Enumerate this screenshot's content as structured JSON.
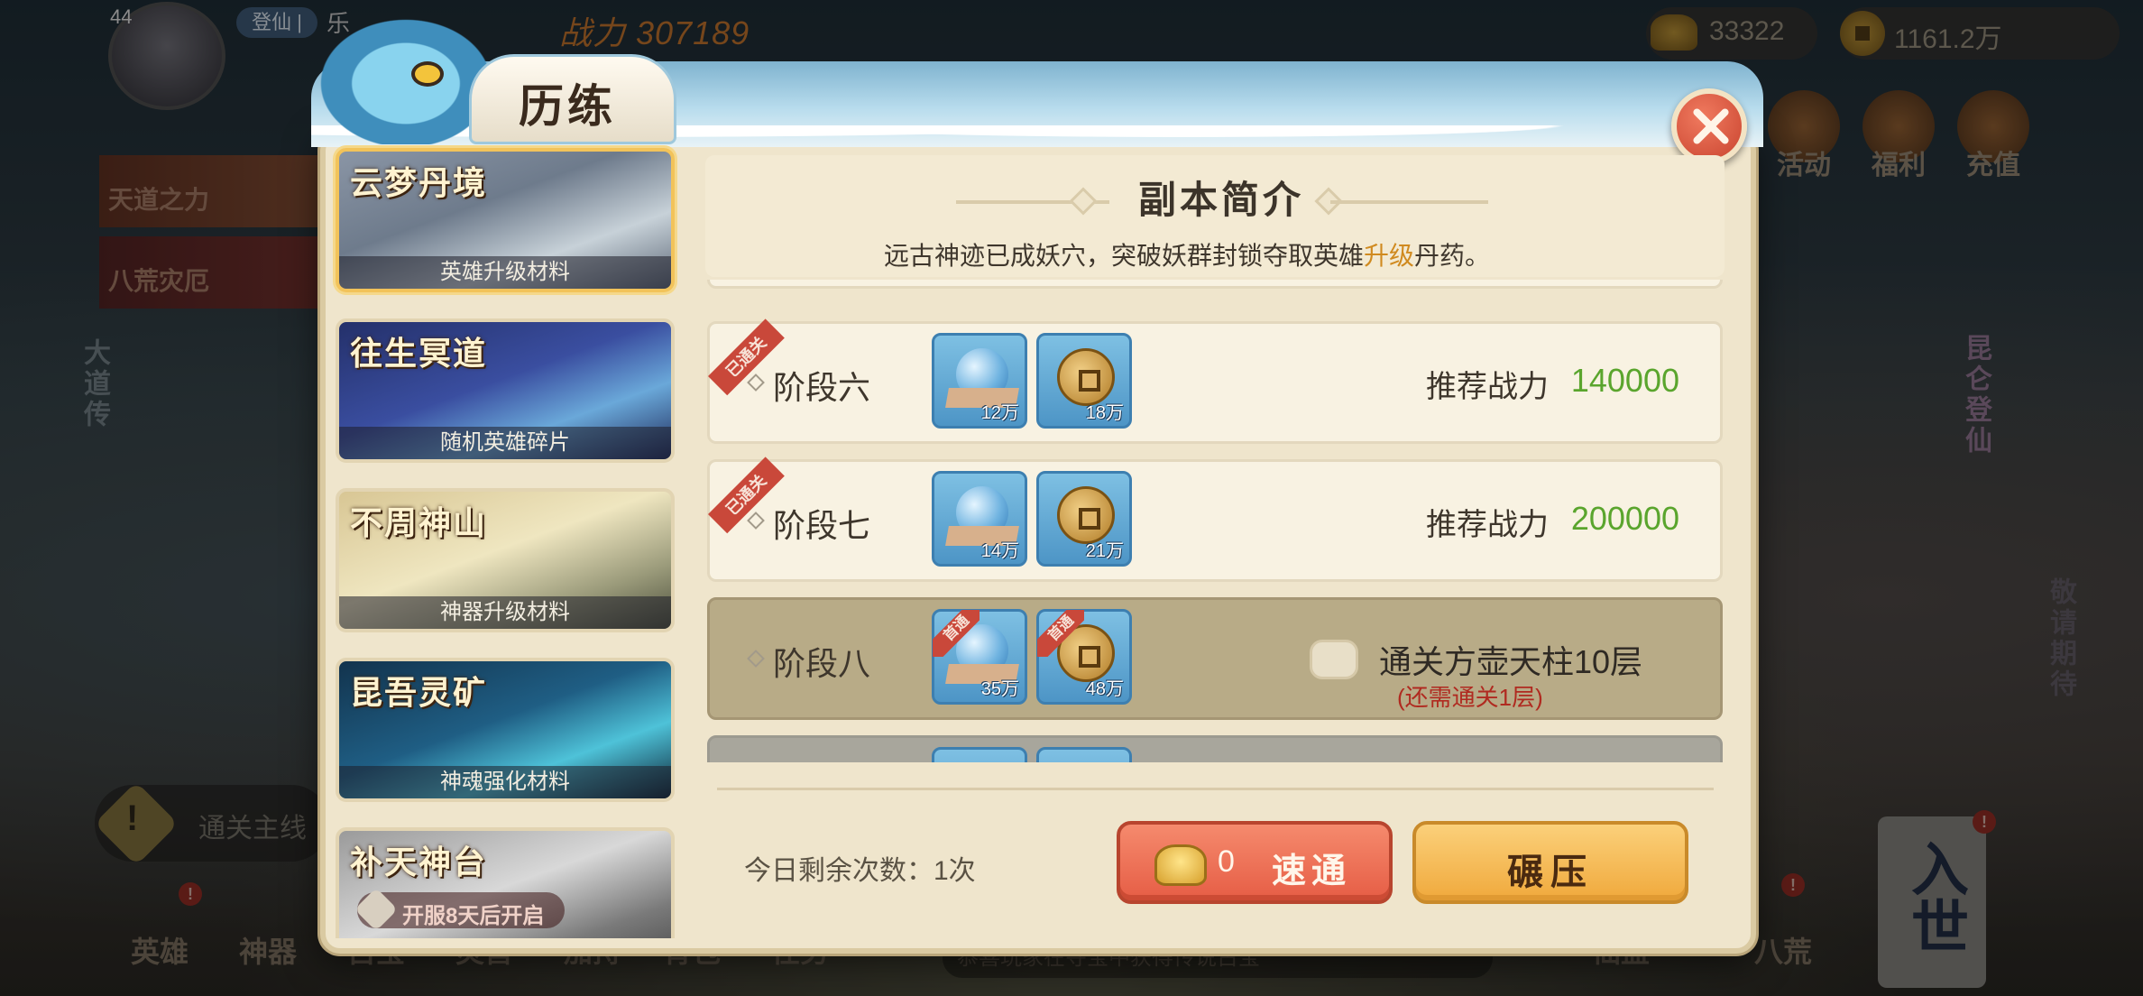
{
  "hud": {
    "level": "44",
    "rank_badge": "登仙 |",
    "player_name": "乐",
    "combat_power": "战力 307189",
    "gold_amount": "33322",
    "coin_amount": "1161.2万",
    "top_menu": [
      "活动",
      "福利",
      "充值"
    ]
  },
  "background": {
    "left_banners": [
      "天道之力",
      "八荒灾厄"
    ],
    "left_vertical": "大道传",
    "right_vertical": "昆仑登仙",
    "right_vertical2": "敬请期待",
    "quest_text": "通关主线",
    "bottom_menu": [
      "英雄",
      "神器",
      "古宝",
      "灵兽",
      "加持",
      "背包",
      "任务"
    ],
    "bottom_right_menu": [
      "仙盟",
      "八荒"
    ],
    "ticker": "恭喜玩家在夺宝中获得传说古宝",
    "scroll_button": "入世"
  },
  "modal": {
    "title": "历练",
    "categories": [
      {
        "name": "云梦丹境",
        "desc": "英雄升级材料",
        "selected": true
      },
      {
        "name": "往生冥道",
        "desc": "随机英雄碎片"
      },
      {
        "name": "不周神山",
        "desc": "神器升级材料"
      },
      {
        "name": "昆吾灵矿",
        "desc": "神魂强化材料"
      },
      {
        "name": "补天神台",
        "lock_text": "开服8天后开启"
      }
    ],
    "intro": {
      "title": "副本简介",
      "desc_before": "远古神迹已成妖穴，突破妖群封锁夺取英雄",
      "desc_highlight": "升级",
      "desc_after": "丹药。"
    },
    "stages": [
      {
        "name": "阶段六",
        "cleared_tag": "已通关",
        "items": [
          {
            "icon": "blue-orb-icon",
            "qty": "12万"
          },
          {
            "icon": "copper-coin-icon",
            "qty": "18万"
          }
        ],
        "rec_label": "推荐战力",
        "rec_value": "140000"
      },
      {
        "name": "阶段七",
        "cleared_tag": "已通关",
        "items": [
          {
            "icon": "blue-orb-icon",
            "qty": "14万"
          },
          {
            "icon": "copper-coin-icon",
            "qty": "21万"
          }
        ],
        "rec_label": "推荐战力",
        "rec_value": "200000"
      },
      {
        "name": "阶段八",
        "items": [
          {
            "icon": "blue-orb-icon",
            "qty": "35万",
            "first_tag": "首通"
          },
          {
            "icon": "copper-coin-icon",
            "qty": "48万",
            "first_tag": "首通"
          }
        ],
        "requirement": "通关方壶天柱10层",
        "requirement_sub": "(还需通关1层)"
      }
    ],
    "remaining_label": "今日剩余次数：1次",
    "sweep_cost": "0",
    "sweep_label": "速通",
    "crush_label": "碾压"
  },
  "colors": {
    "accent_green": "#5aa52d",
    "accent_red": "#b02a20",
    "highlight_orange": "#d08a1f"
  }
}
